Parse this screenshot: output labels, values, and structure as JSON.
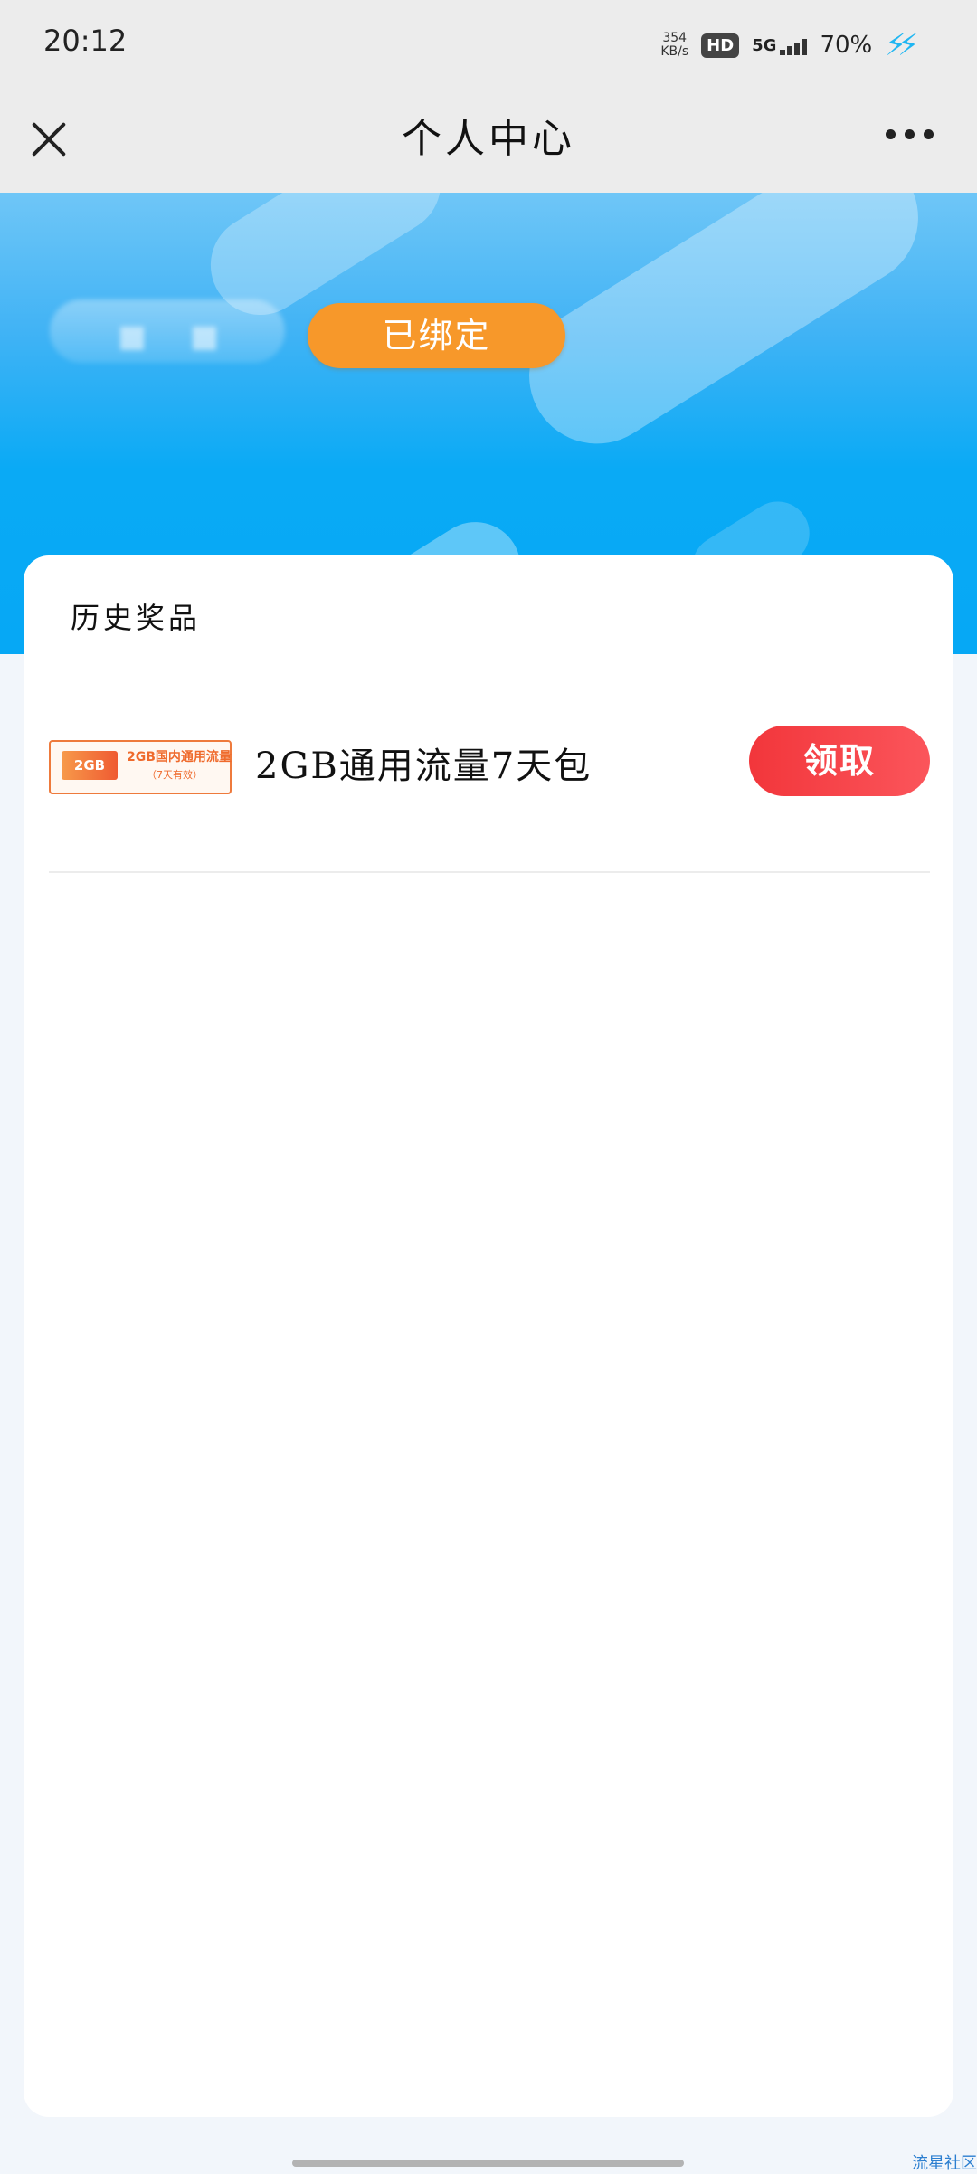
{
  "status_bar": {
    "time": "20:12",
    "net_speed_value": "354",
    "net_speed_unit": "KB/s",
    "hd_label": "HD",
    "network_label": "5G",
    "battery_percent": "70%",
    "icons": [
      "hd-icon",
      "signal-5g-icon",
      "charging-icon"
    ]
  },
  "title_bar": {
    "title": "个人中心",
    "close_icon": "close-icon",
    "more_icon": "more-icon"
  },
  "banner": {
    "bound_status": "已绑定",
    "accent_color": "#f7982a"
  },
  "history": {
    "section_title": "历史奖品",
    "prizes": [
      {
        "thumb_tag": "2GB",
        "thumb_title": "2GB国内通用流量",
        "thumb_subtitle": "（7天有效）",
        "name": "2GB通用流量7天包",
        "action_label": "领取"
      }
    ]
  },
  "footer": {
    "link_text": "流星社区"
  },
  "colors": {
    "banner_blue": "#06a8f5",
    "claim_red": "#f2363b",
    "page_bg": "#f2f6fb"
  }
}
